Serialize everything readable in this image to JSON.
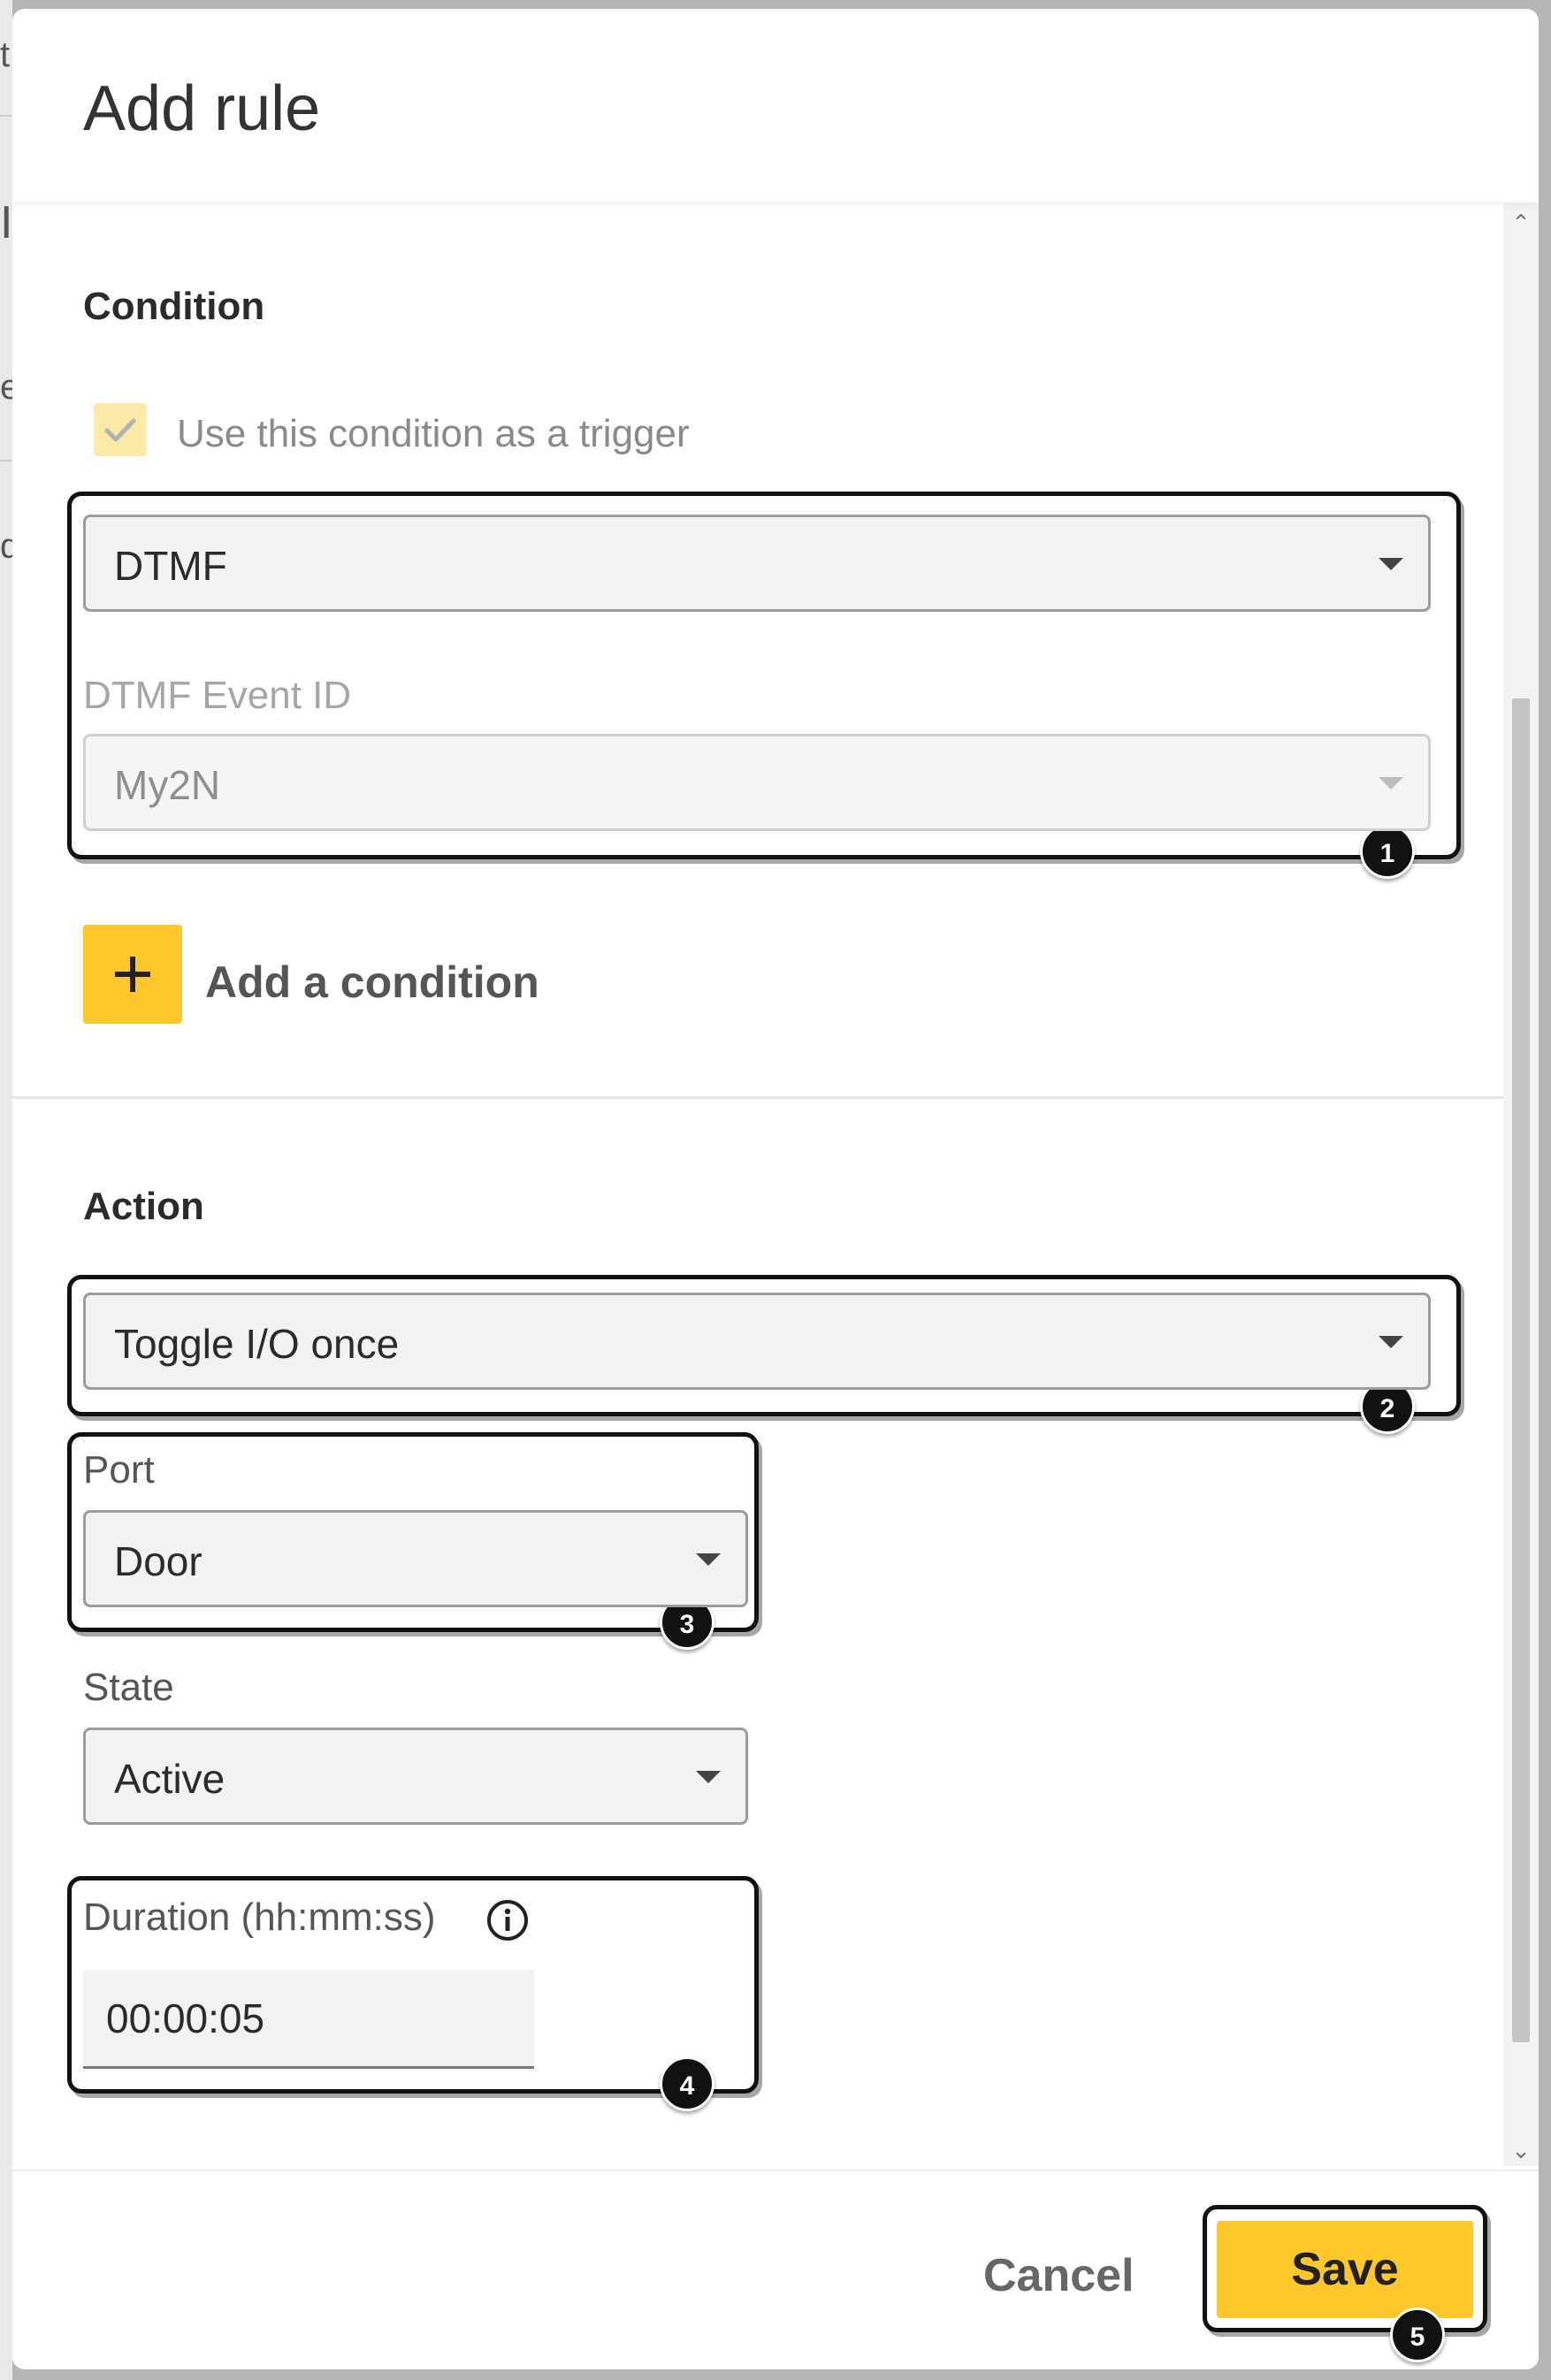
{
  "background": {
    "glimpse_chars": [
      "t",
      "I",
      "e",
      "d"
    ]
  },
  "dialog": {
    "title": "Add rule"
  },
  "condition": {
    "section_title": "Condition",
    "trigger_checkbox": {
      "label": "Use this condition as a trigger",
      "checked": true
    },
    "type_select": {
      "value": "DTMF"
    },
    "event_id": {
      "label": "DTMF Event ID",
      "value": "My2N",
      "disabled": true
    },
    "add_button_label": "Add a condition"
  },
  "action": {
    "section_title": "Action",
    "type_select": {
      "value": "Toggle I/O once"
    },
    "port": {
      "label": "Port",
      "value": "Door"
    },
    "state": {
      "label": "State",
      "value": "Active"
    },
    "duration": {
      "label": "Duration (hh:mm:ss)",
      "value": "00:00:05"
    }
  },
  "callouts": [
    "1",
    "2",
    "3",
    "4",
    "5"
  ],
  "footer": {
    "cancel_label": "Cancel",
    "save_label": "Save"
  },
  "colors": {
    "accent": "#ffc72c",
    "checkbox_bg": "#fbe9a8",
    "callout_border": "#111111"
  }
}
